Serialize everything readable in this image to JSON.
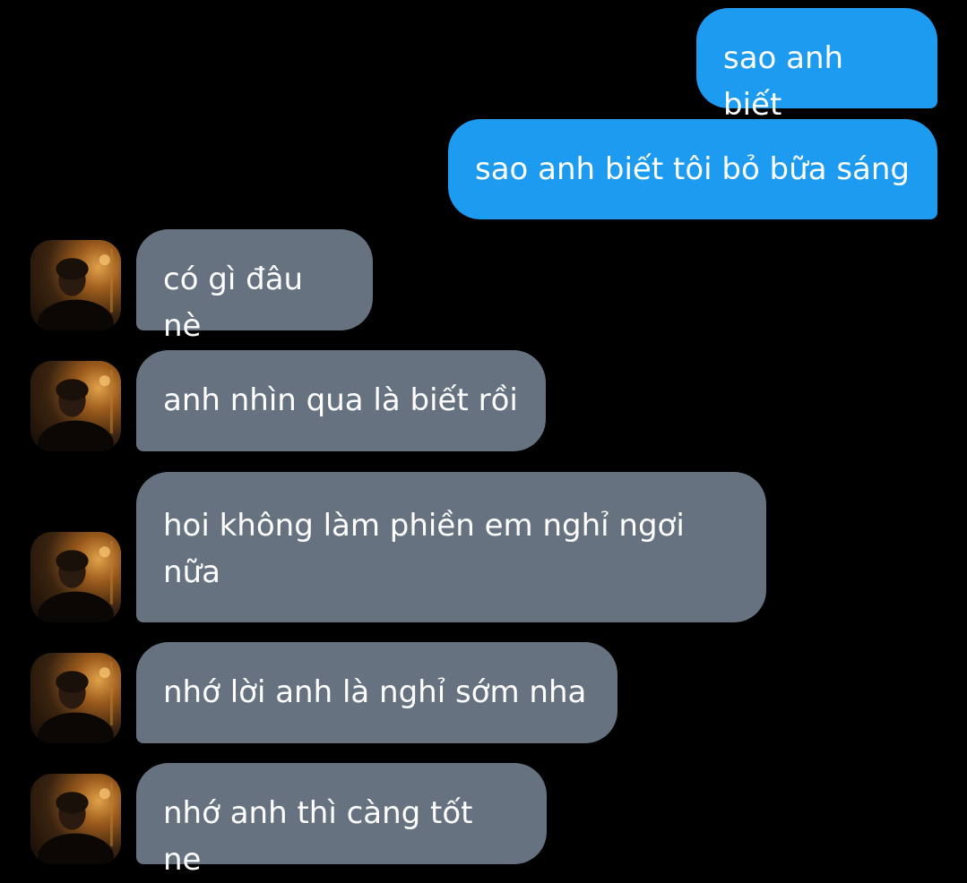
{
  "conversation": {
    "sent": [
      {
        "text": "sao anh biết"
      },
      {
        "text": "sao anh biết tôi bỏ bữa sáng"
      }
    ],
    "received": [
      {
        "text": "có gì đâu nè",
        "avatar_icon": "contact-avatar-photo"
      },
      {
        "text": "anh nhìn qua là biết rồi",
        "avatar_icon": "contact-avatar-photo"
      },
      {
        "text": "hoi không làm phiền em nghỉ ngơi nữa",
        "avatar_icon": "contact-avatar-photo"
      },
      {
        "text": "nhớ lời anh là nghỉ sớm nha",
        "avatar_icon": "contact-avatar-photo"
      },
      {
        "text": "nhớ anh thì càng tốt ne",
        "avatar_icon": "contact-avatar-photo"
      }
    ]
  },
  "colors": {
    "background": "#000000",
    "sent_bubble": "#1d9bf0",
    "received_bubble": "#66727f",
    "text": "#ffffff"
  }
}
